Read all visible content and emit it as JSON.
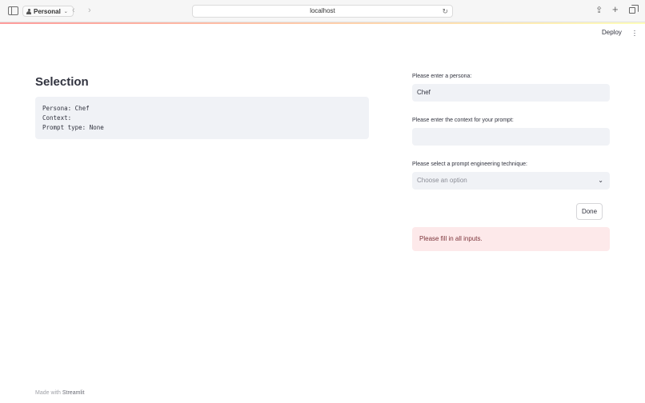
{
  "browser": {
    "profile_label": "Personal",
    "url": "localhost"
  },
  "header": {
    "deploy_label": "Deploy"
  },
  "main": {
    "title": "Selection",
    "code_lines": [
      "Persona: Chef",
      "Context:",
      "Prompt type: None"
    ]
  },
  "form": {
    "persona_label": "Please enter a persona:",
    "persona_value": "Chef",
    "context_label": "Please enter the context for your prompt:",
    "context_value": "",
    "technique_label": "Please select a prompt engineering technique:",
    "technique_placeholder": "Choose an option",
    "done_label": "Done",
    "alert_text": "Please fill in all inputs."
  },
  "footer": {
    "made_with": "Made with",
    "brand": "Streamlit"
  },
  "colors": {
    "alert_bg": "#fde9ea",
    "alert_text": "#7d353b",
    "input_bg": "#f0f2f6"
  }
}
